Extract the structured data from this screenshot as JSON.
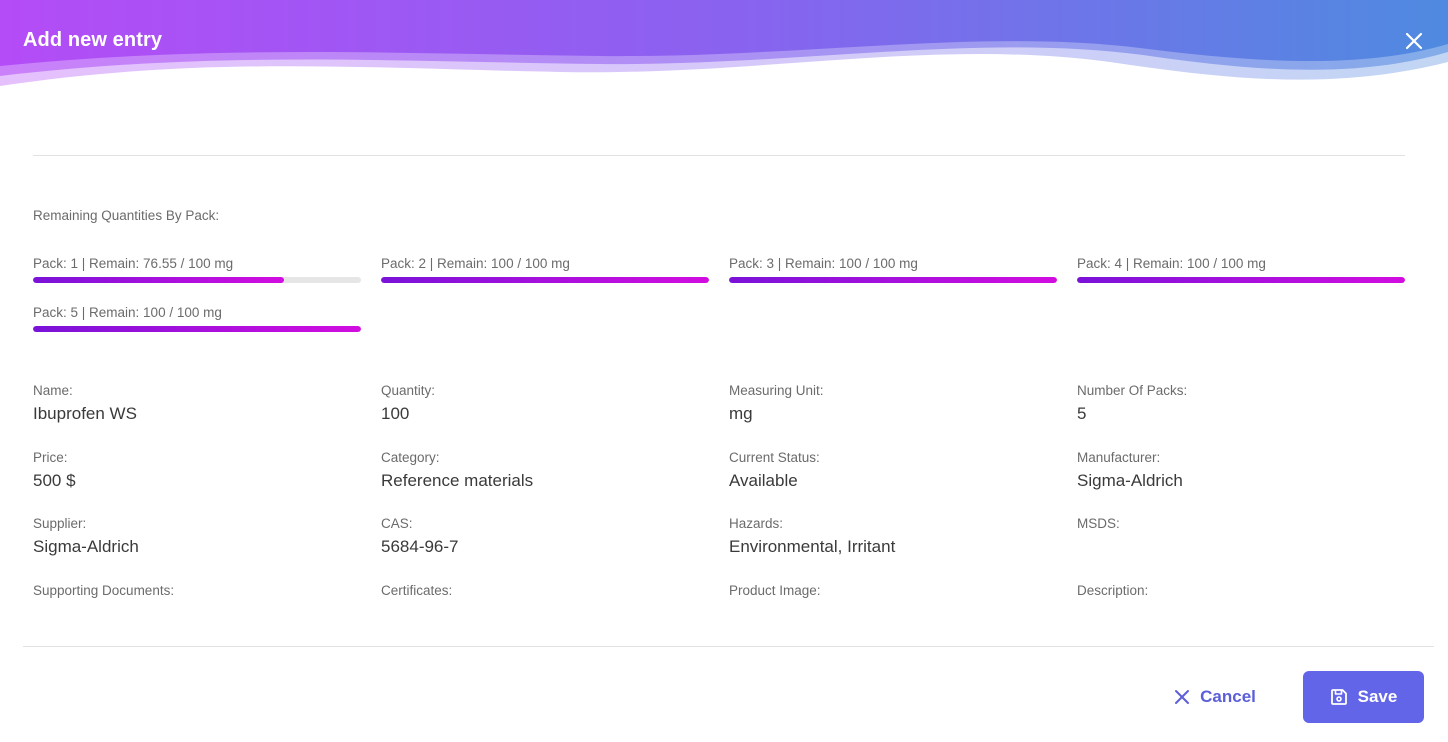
{
  "dialog": {
    "title": "Add new entry"
  },
  "colors": {
    "header_gradient_start": "#b44cf7",
    "header_gradient_end": "#4f8ae0",
    "progress_start": "#7a12d8",
    "progress_end": "#d20de0",
    "primary": "#6265e8"
  },
  "packs_section": {
    "label": "Remaining Quantities By Pack:",
    "packs": [
      {
        "label": "Pack: 1 | Remain: 76.55 / 100 mg",
        "fraction": 0.7655
      },
      {
        "label": "Pack: 2 | Remain: 100 / 100 mg",
        "fraction": 1.0
      },
      {
        "label": "Pack: 3 | Remain: 100 / 100 mg",
        "fraction": 1.0
      },
      {
        "label": "Pack: 4 | Remain: 100 / 100 mg",
        "fraction": 1.0
      },
      {
        "label": "Pack: 5 | Remain: 100 / 100 mg",
        "fraction": 1.0
      }
    ]
  },
  "fields": [
    {
      "label": "Name:",
      "value": "Ibuprofen WS"
    },
    {
      "label": "Quantity:",
      "value": "100"
    },
    {
      "label": "Measuring Unit:",
      "value": "mg"
    },
    {
      "label": "Number Of Packs:",
      "value": "5"
    },
    {
      "label": "Price:",
      "value": "500 $"
    },
    {
      "label": "Category:",
      "value": "Reference materials"
    },
    {
      "label": "Current Status:",
      "value": "Available"
    },
    {
      "label": "Manufacturer:",
      "value": "Sigma-Aldrich"
    },
    {
      "label": "Supplier:",
      "value": "Sigma-Aldrich"
    },
    {
      "label": "CAS:",
      "value": "5684-96-7"
    },
    {
      "label": "Hazards:",
      "value": "Environmental, Irritant"
    },
    {
      "label": "MSDS:",
      "value": ""
    },
    {
      "label": "Supporting Documents:",
      "value": ""
    },
    {
      "label": "Certificates:",
      "value": ""
    },
    {
      "label": "Product Image:",
      "value": ""
    },
    {
      "label": "Description:",
      "value": ""
    }
  ],
  "footer": {
    "cancel_label": "Cancel",
    "cancel_icon": "close-icon",
    "save_label": "Save",
    "save_icon": "floppy-disk-icon"
  },
  "header_close_icon": "close-icon"
}
